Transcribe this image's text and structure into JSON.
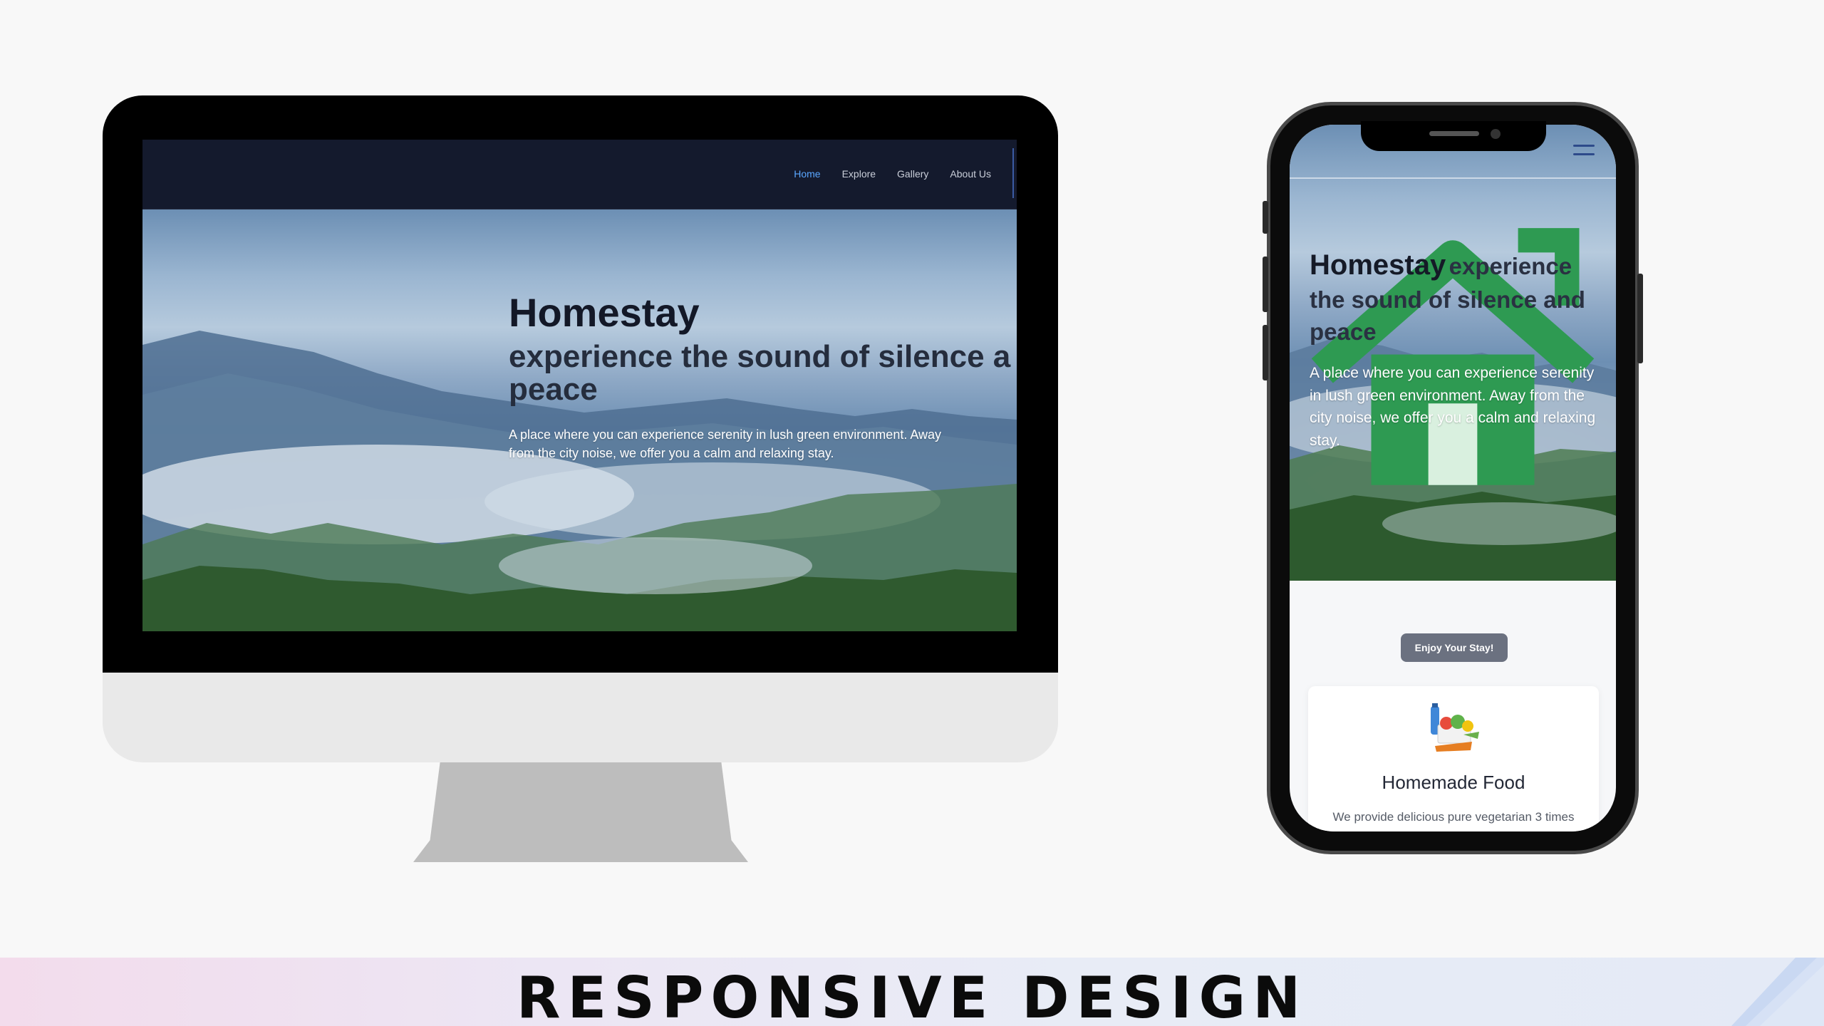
{
  "desktop": {
    "nav": {
      "links": [
        "Home",
        "Explore",
        "Gallery",
        "About Us"
      ],
      "active_color": "#5aa7ff"
    },
    "hero": {
      "title": "Homestay",
      "subtitle": "experience the sound of silence a peace",
      "description": "A place where you can experience serenity in lush green environment. Away from the city noise, we offer you a calm and relaxing stay."
    }
  },
  "mobile": {
    "logo_icon": "house-logo-icon",
    "menu_icon": "hamburger-menu-icon",
    "hero": {
      "title": "Homestay",
      "subtitle": "experience the sound of silence and peace",
      "description": "A place where you can experience serenity in lush green environment. Away from the city noise, we offer you a calm and relaxing stay."
    },
    "cta_label": "Enjoy Your Stay!",
    "feature": {
      "icon": "food-icon",
      "title": "Homemade Food",
      "description": "We provide delicious pure vegetarian 3 times"
    }
  },
  "banner": {
    "title": "RESPONSIVE DESIGN"
  }
}
